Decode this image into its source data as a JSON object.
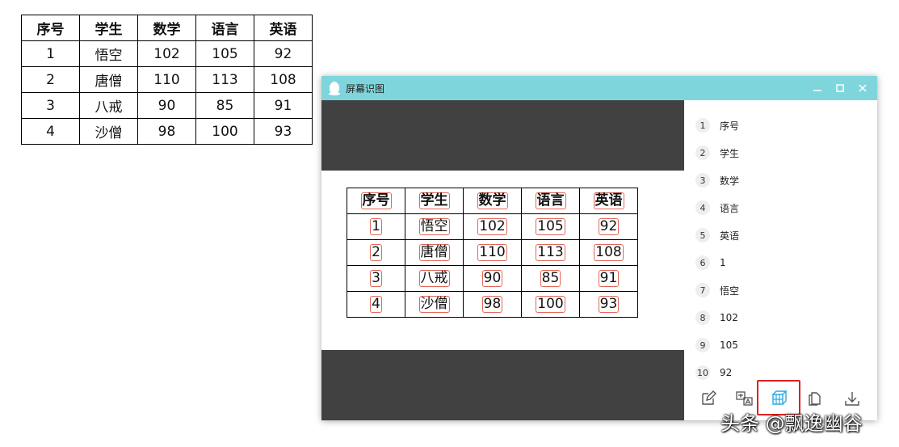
{
  "source_table": {
    "headers": [
      "序号",
      "学生",
      "数学",
      "语言",
      "英语"
    ],
    "rows": [
      [
        "1",
        "悟空",
        "102",
        "105",
        "92"
      ],
      [
        "2",
        "唐僧",
        "110",
        "113",
        "108"
      ],
      [
        "3",
        "八戒",
        "90",
        "85",
        "91"
      ],
      [
        "4",
        "沙僧",
        "98",
        "100",
        "93"
      ]
    ]
  },
  "window": {
    "title": "屏幕识图",
    "accent_color": "#7fd5dc"
  },
  "captured_table": {
    "headers": [
      "序号",
      "学生",
      "数学",
      "语言",
      "英语"
    ],
    "rows": [
      [
        "1",
        "悟空",
        "102",
        "105",
        "92"
      ],
      [
        "2",
        "唐僧",
        "110",
        "113",
        "108"
      ],
      [
        "3",
        "八戒",
        "90",
        "85",
        "91"
      ],
      [
        "4",
        "沙僧",
        "98",
        "100",
        "93"
      ]
    ]
  },
  "results": [
    {
      "num": "1",
      "text": "序号"
    },
    {
      "num": "2",
      "text": "学生"
    },
    {
      "num": "3",
      "text": "数学"
    },
    {
      "num": "4",
      "text": "语言"
    },
    {
      "num": "5",
      "text": "英语"
    },
    {
      "num": "6",
      "text": "1"
    },
    {
      "num": "7",
      "text": "悟空"
    },
    {
      "num": "8",
      "text": "102"
    },
    {
      "num": "9",
      "text": "105"
    },
    {
      "num": "10",
      "text": "92"
    }
  ],
  "toolbar": {
    "icons": [
      "edit-icon",
      "translate-icon",
      "table-recognize-icon",
      "copy-icon",
      "download-icon"
    ],
    "active_color": "#2aa9e0",
    "highlight_color": "#e02020"
  },
  "watermark": "头条 @飘逸幽谷"
}
